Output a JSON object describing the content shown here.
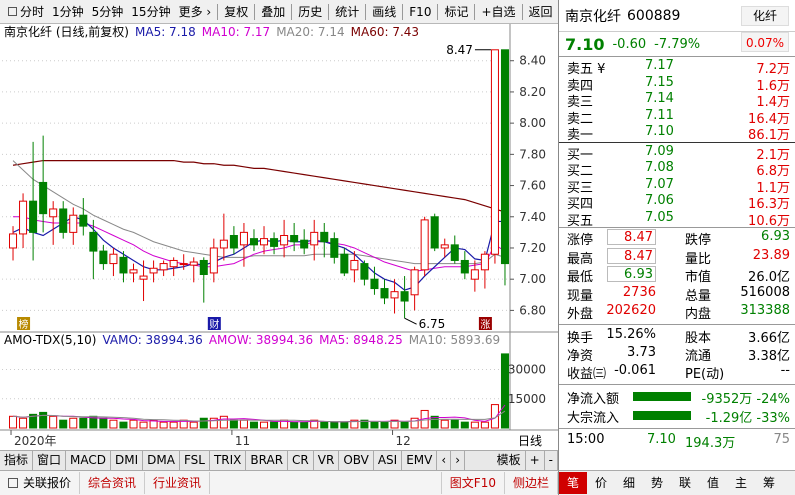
{
  "toolbar": {
    "items": [
      {
        "label": "分时",
        "check": true
      },
      {
        "label": "1分钟"
      },
      {
        "label": "5分钟"
      },
      {
        "label": "15分钟"
      },
      {
        "label": "更多 ›"
      },
      {
        "label": "复权",
        "sep": true
      },
      {
        "label": "叠加",
        "sep": true
      },
      {
        "label": "历史",
        "sep": true
      },
      {
        "label": "统计",
        "sep": true
      },
      {
        "label": "画线",
        "sep": true
      },
      {
        "label": "F10",
        "sep": true
      },
      {
        "label": "标记",
        "sep": true
      },
      {
        "label": "+自选",
        "sep": true
      },
      {
        "label": "返回",
        "sep": true
      }
    ]
  },
  "main_chart": {
    "legend": {
      "title": "南京化纤 (日线,前复权)",
      "ma5": "MA5: 7.18",
      "ma10": "MA10: 7.17",
      "ma20": "MA20: 7.14",
      "ma60": "MA60: 7.43"
    },
    "yticks": [
      "8.40",
      "8.20",
      "8.00",
      "7.80",
      "7.60",
      "7.40",
      "7.20",
      "7.00",
      "6.80"
    ],
    "high_label": "8.47",
    "low_label": "6.75",
    "markers": [
      "榜",
      "财",
      "涨"
    ]
  },
  "volume_chart": {
    "legend": {
      "title": "AMO-TDX(5,10)",
      "vamo": "VAMO: 38994.36",
      "amow": "AMOW: 38994.36",
      "ma5": "MA5: 8948.25",
      "ma10": "MA10: 5893.69"
    },
    "yticks": [
      "30000",
      "15000"
    ]
  },
  "xaxis": {
    "labels": [
      "2020年",
      "11",
      "12"
    ],
    "period": "日线"
  },
  "chart_data": {
    "type": "candlestick",
    "ohlc": [
      [
        7.2,
        7.34,
        7.12,
        7.29
      ],
      [
        7.29,
        7.55,
        7.2,
        7.5
      ],
      [
        7.5,
        7.88,
        7.12,
        7.3
      ],
      [
        7.62,
        7.92,
        7.3,
        7.42
      ],
      [
        7.4,
        7.5,
        7.22,
        7.45
      ],
      [
        7.45,
        7.5,
        7.26,
        7.3
      ],
      [
        7.3,
        7.46,
        7.22,
        7.41
      ],
      [
        7.41,
        7.52,
        7.28,
        7.34
      ],
      [
        7.3,
        7.38,
        7.0,
        7.18
      ],
      [
        7.18,
        7.22,
        7.06,
        7.1
      ],
      [
        7.1,
        7.2,
        7.02,
        7.16
      ],
      [
        7.14,
        7.18,
        6.98,
        7.04
      ],
      [
        7.04,
        7.1,
        6.98,
        7.06
      ],
      [
        7.0,
        7.12,
        6.86,
        7.02
      ],
      [
        7.04,
        7.12,
        6.98,
        7.07
      ],
      [
        7.06,
        7.12,
        7.02,
        7.1
      ],
      [
        7.08,
        7.14,
        7.02,
        7.12
      ],
      [
        7.1,
        7.16,
        7.06,
        7.1
      ],
      [
        7.09,
        7.14,
        6.98,
        7.11
      ],
      [
        7.12,
        7.14,
        6.85,
        7.03
      ],
      [
        7.04,
        7.26,
        6.98,
        7.2
      ],
      [
        7.2,
        7.42,
        7.12,
        7.25
      ],
      [
        7.28,
        7.34,
        7.16,
        7.2
      ],
      [
        7.22,
        7.36,
        7.08,
        7.3
      ],
      [
        7.26,
        7.32,
        7.18,
        7.22
      ],
      [
        7.22,
        7.34,
        7.16,
        7.26
      ],
      [
        7.26,
        7.3,
        7.16,
        7.21
      ],
      [
        7.22,
        7.38,
        7.14,
        7.28
      ],
      [
        7.28,
        7.36,
        7.18,
        7.24
      ],
      [
        7.25,
        7.32,
        7.16,
        7.2
      ],
      [
        7.22,
        7.38,
        7.12,
        7.3
      ],
      [
        7.3,
        7.36,
        7.14,
        7.24
      ],
      [
        7.26,
        7.3,
        7.1,
        7.14
      ],
      [
        7.16,
        7.2,
        7.02,
        7.04
      ],
      [
        7.06,
        7.18,
        6.98,
        7.12
      ],
      [
        7.1,
        7.12,
        6.96,
        7.0
      ],
      [
        7.0,
        7.08,
        6.9,
        6.94
      ],
      [
        6.94,
        7.0,
        6.84,
        6.88
      ],
      [
        6.88,
        7.0,
        6.78,
        6.92
      ],
      [
        6.92,
        7.02,
        6.75,
        6.86
      ],
      [
        6.9,
        7.08,
        6.8,
        7.06
      ],
      [
        7.06,
        7.4,
        7.02,
        7.38
      ],
      [
        7.4,
        7.42,
        7.18,
        7.2
      ],
      [
        7.2,
        7.26,
        7.14,
        7.22
      ],
      [
        7.22,
        7.28,
        7.1,
        7.12
      ],
      [
        7.12,
        7.18,
        7.0,
        7.04
      ],
      [
        7.0,
        7.12,
        6.92,
        7.06
      ],
      [
        7.06,
        7.18,
        6.94,
        7.16
      ],
      [
        7.16,
        8.47,
        7.1,
        8.47
      ],
      [
        8.47,
        8.47,
        6.96,
        7.1
      ]
    ],
    "volume": [
      6,
      5,
      7,
      8,
      6,
      4,
      5,
      5,
      6,
      5,
      4,
      3,
      4,
      3,
      4,
      3,
      3,
      4,
      3,
      5,
      5,
      6,
      4,
      4,
      3,
      3,
      3,
      4,
      3,
      3,
      4,
      3,
      3,
      3,
      4,
      4,
      3,
      3,
      4,
      3,
      5,
      9,
      6,
      4,
      4,
      3,
      3,
      3,
      12,
      38
    ],
    "ma5": [
      7.3,
      7.33,
      7.3,
      7.28,
      7.32,
      7.36,
      7.4,
      7.38,
      7.32,
      7.25,
      7.2,
      7.16,
      7.12,
      7.08,
      7.06,
      7.06,
      7.07,
      7.08,
      7.1,
      7.09,
      7.11,
      7.14,
      7.16,
      7.2,
      7.24,
      7.25,
      7.24,
      7.25,
      7.24,
      7.24,
      7.25,
      7.24,
      7.22,
      7.2,
      7.16,
      7.1,
      7.04,
      7.0,
      6.98,
      6.93,
      6.95,
      7.02,
      7.08,
      7.14,
      7.2,
      7.19,
      7.13,
      7.12,
      7.37,
      7.37
    ],
    "ma10": [
      7.4,
      7.4,
      7.38,
      7.37,
      7.36,
      7.36,
      7.36,
      7.36,
      7.34,
      7.31,
      7.28,
      7.25,
      7.22,
      7.18,
      7.15,
      7.13,
      7.11,
      7.1,
      7.09,
      7.08,
      7.08,
      7.09,
      7.1,
      7.13,
      7.16,
      7.18,
      7.19,
      7.2,
      7.22,
      7.22,
      7.24,
      7.24,
      7.23,
      7.22,
      7.2,
      7.17,
      7.14,
      7.11,
      7.09,
      7.07,
      7.05,
      7.06,
      7.07,
      7.08,
      7.08,
      7.08,
      7.09,
      7.1,
      7.22,
      7.18
    ],
    "ma20": [
      7.76,
      7.7,
      7.64,
      7.6,
      7.56,
      7.52,
      7.48,
      7.45,
      7.41,
      7.38,
      7.35,
      7.32,
      7.3,
      7.27,
      7.24,
      7.22,
      7.2,
      7.18,
      7.17,
      7.16,
      7.15,
      7.14,
      7.14,
      7.14,
      7.15,
      7.15,
      7.15,
      7.15,
      7.15,
      7.15,
      7.16,
      7.16,
      7.16,
      7.16,
      7.16,
      7.15,
      7.14,
      7.13,
      7.12,
      7.11,
      7.1,
      7.1,
      7.1,
      7.1,
      7.1,
      7.1,
      7.1,
      7.11,
      7.16,
      7.14
    ],
    "ma60": [
      7.73,
      7.74,
      7.75,
      7.76,
      7.76,
      7.76,
      7.76,
      7.76,
      7.76,
      7.76,
      7.76,
      7.76,
      7.76,
      7.76,
      7.76,
      7.76,
      7.76,
      7.75,
      7.75,
      7.74,
      7.74,
      7.73,
      7.73,
      7.72,
      7.71,
      7.71,
      7.7,
      7.69,
      7.68,
      7.67,
      7.66,
      7.65,
      7.64,
      7.63,
      7.62,
      7.61,
      7.6,
      7.59,
      7.58,
      7.57,
      7.56,
      7.55,
      7.54,
      7.53,
      7.52,
      7.51,
      7.49,
      7.47,
      7.45,
      7.43
    ],
    "ylim": [
      6.7,
      8.52
    ]
  },
  "right_panel": {
    "stock_name": "南京化纤",
    "code": "600889",
    "badge": "化纤",
    "badge_pct": "0.07%",
    "price": "7.10",
    "change": "-0.60",
    "change_pct": "-7.79%",
    "asks": [
      {
        "label": "卖五 ¥",
        "price": "7.17",
        "vol": "7.2万"
      },
      {
        "label": "卖四",
        "price": "7.15",
        "vol": "1.6万"
      },
      {
        "label": "卖三",
        "price": "7.14",
        "vol": "1.4万"
      },
      {
        "label": "卖二",
        "price": "7.11",
        "vol": "16.4万"
      },
      {
        "label": "卖一",
        "price": "7.10",
        "vol": "86.1万"
      }
    ],
    "bids": [
      {
        "label": "买一",
        "price": "7.09",
        "vol": "2.1万"
      },
      {
        "label": "买二",
        "price": "7.08",
        "vol": "6.8万"
      },
      {
        "label": "买三",
        "price": "7.07",
        "vol": "1.1万"
      },
      {
        "label": "买四",
        "price": "7.06",
        "vol": "16.3万"
      },
      {
        "label": "买五",
        "price": "7.05",
        "vol": "10.6万"
      }
    ],
    "stats1": [
      {
        "k": "涨停",
        "v": "8.47",
        "c": "#e00000",
        "box": true,
        "k2": "跌停",
        "v2": "6.93",
        "c2": "#008000"
      },
      {
        "k": "最高",
        "v": "8.47",
        "c": "#e00000",
        "box": true,
        "k2": "量比",
        "v2": "23.89",
        "c2": "#e00000"
      },
      {
        "k": "最低",
        "v": "6.93",
        "c": "#008000",
        "box": true,
        "k2": "市值",
        "v2": "26.0亿",
        "c2": "#000"
      },
      {
        "k": "现量",
        "v": "2736",
        "c": "#e00000",
        "k2": "总量",
        "v2": "516008",
        "c2": "#000"
      },
      {
        "k": "外盘",
        "v": "202620",
        "c": "#e00000",
        "k2": "内盘",
        "v2": "313388",
        "c2": "#008000"
      }
    ],
    "stats2": [
      {
        "k": "换手",
        "v": "15.26%",
        "k2": "股本",
        "v2": "3.66亿"
      },
      {
        "k": "净资",
        "v": "3.73",
        "k2": "流通",
        "v2": "3.38亿"
      },
      {
        "k": "收益㈢",
        "v": "-0.061",
        "k2": "PE(动)",
        "v2": "--"
      }
    ],
    "flows": [
      {
        "k": "净流入额",
        "v": "-9352万 -24%"
      },
      {
        "k": "大宗流入",
        "v": "-1.29亿 -33%"
      }
    ],
    "tick": {
      "time": "15:00",
      "price": "7.10",
      "amount": "194.3万",
      "vol": "75"
    }
  },
  "bottom_tabs": [
    "指标",
    "窗口",
    "MACD",
    "DMI",
    "DMA",
    "FSL",
    "TRIX",
    "BRAR",
    "CR",
    "VR",
    "OBV",
    "ASI",
    "EMV",
    "‹",
    "›",
    "模板",
    "+",
    "-"
  ],
  "footer": {
    "items": [
      "关联报价",
      "综合资讯",
      "行业资讯"
    ],
    "right": [
      "图文F10",
      "侧边栏"
    ]
  },
  "right_footer": [
    "笔",
    "价",
    "细",
    "势",
    "联",
    "值",
    "主",
    "筹"
  ]
}
